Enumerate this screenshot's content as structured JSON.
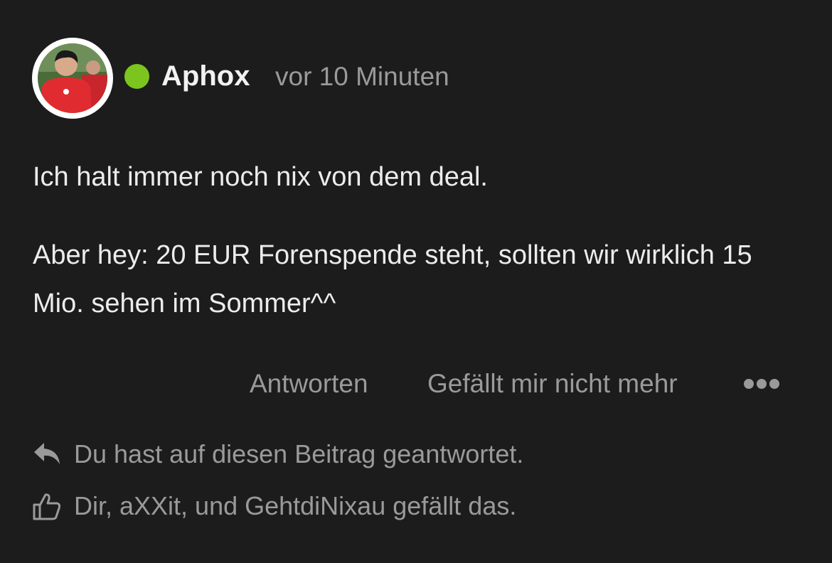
{
  "post": {
    "author": "Aphox",
    "timestamp": "vor 10 Minuten",
    "online_status_color": "#7bc51e",
    "avatar_icon": "user-photo-avatar",
    "paragraphs": [
      "Ich halt immer noch nix von dem deal.",
      "Aber hey: 20 EUR Forenspende steht, sollten wir wirklich 15 Mio. sehen im Sommer^^"
    ]
  },
  "actions": {
    "reply_label": "Antworten",
    "unlike_label": "Gefällt mir nicht mehr",
    "more_icon": "ellipsis-icon"
  },
  "footer": {
    "replied_text": "Du hast auf diesen Beitrag geantwortet.",
    "replied_icon": "reply-arrow-icon",
    "likes_text": "Dir, aXXit, und GehtdiNixau gefällt das.",
    "likes_icon": "thumbs-up-icon"
  },
  "colors": {
    "background": "#1c1c1c",
    "text_primary": "#ececec",
    "text_muted": "#9a9a9a"
  }
}
